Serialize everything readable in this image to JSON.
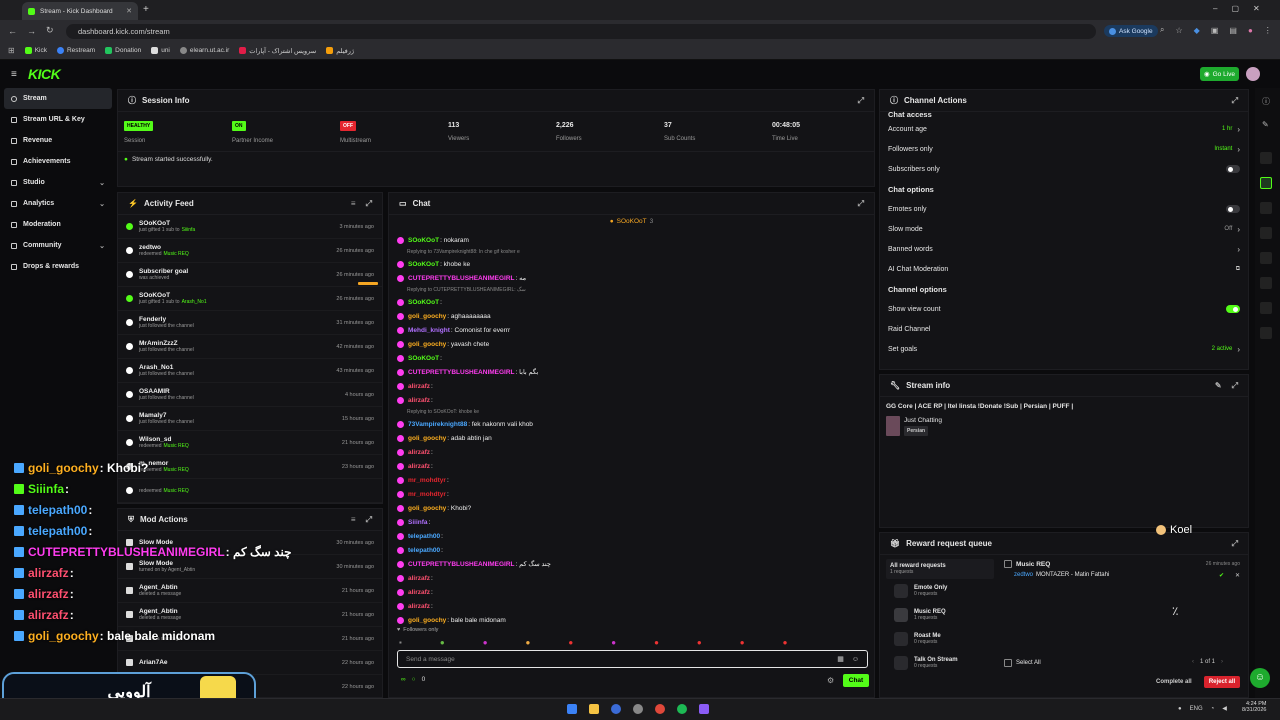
{
  "browser": {
    "tab_title": "Stream - Kick Dashboard",
    "url": "dashboard.kick.com/stream",
    "ask_google": "Ask Google",
    "bookmarks": [
      "Kick",
      "Restream",
      "Donation",
      "uni",
      "elearn.ut.ac.ir",
      "سرویس اشتراک - آپارات",
      "ژرفیلم"
    ]
  },
  "app": {
    "logo": "KICK",
    "go_live": "Go Live"
  },
  "sidebar": {
    "items": [
      {
        "label": "Stream",
        "icon": "stream-icon"
      },
      {
        "label": "Stream URL & Key",
        "icon": "key-icon"
      },
      {
        "label": "Revenue",
        "icon": "revenue-icon"
      },
      {
        "label": "Achievements",
        "icon": "trophy-icon"
      },
      {
        "label": "Studio",
        "icon": "studio-icon",
        "chevron": true
      },
      {
        "label": "Analytics",
        "icon": "chart-icon",
        "chevron": true
      },
      {
        "label": "Moderation",
        "icon": "shield-icon"
      },
      {
        "label": "Community",
        "icon": "people-icon",
        "chevron": true
      },
      {
        "label": "Drops & rewards",
        "icon": "gift-icon"
      }
    ]
  },
  "session": {
    "title": "Session Info",
    "stats": [
      {
        "badge": "HEALTHY",
        "badge_color": "#53fc18",
        "label": "Session"
      },
      {
        "badge": "ON",
        "badge_color": "#53fc18",
        "label": "Partner Income"
      },
      {
        "badge": "OFF",
        "badge_color": "#e5262f",
        "label": "Multistream"
      },
      {
        "value": "113",
        "label": "Viewers"
      },
      {
        "value": "2,226",
        "label": "Followers"
      },
      {
        "value": "37",
        "label": "Sub Counts"
      },
      {
        "value": "00:48:05",
        "label": "Time Live"
      }
    ],
    "notice": "Stream started successfully."
  },
  "activity": {
    "title": "Activity Feed",
    "items": [
      {
        "name": "SOoKOoT",
        "sub": "just gifted 1 sub to",
        "extra": "Siiinfa",
        "time": "3 minutes ago"
      },
      {
        "name": "zedtwo",
        "sub": "redeemed",
        "extra": "Music REQ",
        "time": "26 minutes ago"
      },
      {
        "name": "Subscriber goal",
        "sub": "was achieved",
        "extra": "",
        "time": "26 minutes ago"
      },
      {
        "name": "SOoKOoT",
        "sub": "just gifted 1 sub to",
        "extra": "Arash_No1",
        "time": "26 minutes ago"
      },
      {
        "name": "Fenderly",
        "sub": "just followed the channel",
        "extra": "",
        "time": "31 minutes ago"
      },
      {
        "name": "MrAminZzzZ",
        "sub": "just followed the channel",
        "extra": "",
        "time": "42 minutes ago"
      },
      {
        "name": "Arash_No1",
        "sub": "just followed the channel",
        "extra": "",
        "time": "43 minutes ago"
      },
      {
        "name": "OSAAMIR",
        "sub": "just followed the channel",
        "extra": "",
        "time": "4 hours ago"
      },
      {
        "name": "Mamaly7",
        "sub": "just followed the channel",
        "extra": "",
        "time": "15 hours ago"
      },
      {
        "name": "Wilson_sd",
        "sub": "redeemed",
        "extra": "Music REQ",
        "time": "21 hours ago"
      },
      {
        "name": "m_nemor",
        "sub": "redeemed",
        "extra": "Music REQ",
        "time": "23 hours ago"
      },
      {
        "name": "",
        "sub": "redeemed",
        "extra": "Music REQ",
        "time": ""
      }
    ]
  },
  "modactions": {
    "title": "Mod Actions",
    "items": [
      {
        "name": "Slow Mode",
        "sub": "",
        "time": "30 minutes ago"
      },
      {
        "name": "Slow Mode",
        "sub": "turned on by Agent_Abtin",
        "time": "30 minutes ago"
      },
      {
        "name": "Agent_Abtin",
        "sub": "deleted a message",
        "time": "21 hours ago"
      },
      {
        "name": "Agent_Abtin",
        "sub": "deleted a message",
        "time": "21 hours ago"
      },
      {
        "name": "",
        "sub": "deleted a message",
        "time": "21 hours ago"
      },
      {
        "name": "Arian7Ae",
        "sub": "",
        "time": "22 hours ago"
      },
      {
        "name": "",
        "sub": "",
        "time": "22 hours ago"
      }
    ]
  },
  "chat": {
    "title": "Chat",
    "pinned": "SOoKOoT",
    "pinned_count": "3",
    "input_placeholder": "Send a message",
    "send": "Chat",
    "followers_only": "Followers only",
    "viewer_count": "0",
    "messages": [
      {
        "user": "SOoKOoT",
        "color": "#53fc18",
        "text": ": nokaram"
      },
      {
        "reply": "Replying to 73Vampireknight88: In che gif kosher e"
      },
      {
        "user": "SOoKOoT",
        "color": "#53fc18",
        "text": ": khobe ke"
      },
      {
        "user": "CUTEPRETTYBLUSHEANIMEGIRL",
        "color": "#ff3df0",
        "text": ": مه"
      },
      {
        "reply": "Replying to CUTEPRETTYBLUSHEANIMEGIRL: سگ"
      },
      {
        "user": "SOoKOoT",
        "color": "#53fc18",
        "text": ":"
      },
      {
        "user": "goli_goochy",
        "color": "#ffb020",
        "text": ": aghaaaaaaaa"
      },
      {
        "user": "Mehdi_knight",
        "color": "#b070ff",
        "text": ": Comonist for everrr"
      },
      {
        "user": "goli_goochy",
        "color": "#ffb020",
        "text": ": yavash chete"
      },
      {
        "user": "SOoKOoT",
        "color": "#53fc18",
        "text": ":"
      },
      {
        "user": "CUTEPRETTYBLUSHEANIMEGIRL",
        "color": "#ff3df0",
        "text": ": بگم بابا"
      },
      {
        "user": "alirzafz",
        "color": "#ff5070",
        "text": ":"
      },
      {
        "user": "alirzafz",
        "color": "#ff5070",
        "text": ":"
      },
      {
        "reply": "Replying to SOoKOoT: khobe ke"
      },
      {
        "user": "73Vampireknight88",
        "color": "#4aa8ff",
        "text": ": fek nakonm vali khob"
      },
      {
        "user": "goli_goochy",
        "color": "#ffb020",
        "text": ": adab abtin jan"
      },
      {
        "user": "alirzafz",
        "color": "#ff5070",
        "text": ":"
      },
      {
        "user": "alirzafz",
        "color": "#ff5070",
        "text": ":"
      },
      {
        "user": "mr_mohdtyr",
        "color": "#e5262f",
        "text": ":"
      },
      {
        "user": "mr_mohdtyr",
        "color": "#e5262f",
        "text": ":"
      },
      {
        "user": "goli_goochy",
        "color": "#ffb020",
        "text": ": Khobi?"
      },
      {
        "user": "Siiinfa",
        "color": "#b070ff",
        "text": ":"
      },
      {
        "user": "telepath00",
        "color": "#4aa8ff",
        "text": ":"
      },
      {
        "user": "telepath00",
        "color": "#4aa8ff",
        "text": ":"
      },
      {
        "user": "CUTEPRETTYBLUSHEANIMEGIRL",
        "color": "#ff3df0",
        "text": ": چند سگ کم"
      },
      {
        "user": "alirzafz",
        "color": "#ff5070",
        "text": ":"
      },
      {
        "user": "alirzafz",
        "color": "#ff5070",
        "text": ":"
      },
      {
        "user": "alirzafz",
        "color": "#ff5070",
        "text": ":"
      },
      {
        "user": "goli_goochy",
        "color": "#ffb020",
        "text": ": bale bale midonam"
      }
    ]
  },
  "channel_actions": {
    "title": "Channel Actions",
    "chat_access": {
      "title": "Chat access",
      "options": [
        {
          "label": "Account age",
          "value": "1 hr",
          "kind": "link"
        },
        {
          "label": "Followers only",
          "value": "Instant",
          "kind": "link"
        },
        {
          "label": "Subscribers only",
          "kind": "toggle",
          "on": false
        }
      ]
    },
    "chat_options": {
      "title": "Chat options",
      "options": [
        {
          "label": "Emotes only",
          "kind": "toggle",
          "on": false
        },
        {
          "label": "Slow mode",
          "value": "Off",
          "kind": "link"
        },
        {
          "label": "Banned words",
          "kind": "link"
        },
        {
          "label": "AI Chat Moderation",
          "kind": "ext"
        }
      ]
    },
    "channel_options": {
      "title": "Channel options",
      "options": [
        {
          "label": "Show view count",
          "kind": "toggle",
          "on": true
        },
        {
          "label": "Raid Channel",
          "kind": "none"
        },
        {
          "label": "Set goals",
          "value": "2 active",
          "kind": "link"
        }
      ]
    }
  },
  "stream_info": {
    "title": "Stream info",
    "stream_title": "GG Core | ACE RP | Itel Iinsta !Donate !Sub | Persian | PUFF |",
    "category": "Just Chatting",
    "tag": "Persian"
  },
  "reward_queue": {
    "title": "Reward request queue",
    "all": "All reward requests",
    "all_sub": "1 requests",
    "rewards": [
      {
        "name": "Emote Only",
        "sub": "0 requests"
      },
      {
        "name": "Music REQ",
        "sub": "1 requests"
      },
      {
        "name": "Roast Me",
        "sub": "0 requests"
      },
      {
        "name": "Talk On Stream",
        "sub": "0 requests"
      }
    ],
    "request": {
      "title": "Music REQ",
      "time": "26 minutes ago",
      "user": "zedtwo",
      "text": "MONTAZER - Matin Fattahi"
    },
    "select_all": "Select All",
    "pagination": "1 of 1",
    "complete": "Complete all",
    "reject": "Reject all"
  },
  "overlay": {
    "lines": [
      {
        "user": "goli_goochy",
        "color": "#ffb020",
        "text": ": Khobi?"
      },
      {
        "user": "Siiinfa",
        "color": "#53fc18",
        "text": ":"
      },
      {
        "user": "telepath00",
        "color": "#4aa8ff",
        "text": ":"
      },
      {
        "user": "telepath00",
        "color": "#4aa8ff",
        "text": ":"
      },
      {
        "user": "CUTEPRETTYBLUSHEANIMEGIRL",
        "color": "#ff3df0",
        "text": ": چند سگ کم"
      },
      {
        "user": "alirzafz",
        "color": "#ff5070",
        "text": ":"
      },
      {
        "user": "alirzafz",
        "color": "#ff5070",
        "text": ":"
      },
      {
        "user": "alirzafz",
        "color": "#ff5070",
        "text": ":"
      },
      {
        "user": "goli_goochy",
        "color": "#ffb020",
        "text": ": bale bale midonam"
      }
    ],
    "banner": "آلووپی",
    "koel": "Koel"
  },
  "taskbar": {
    "lang": "ENG",
    "time": "4:24 PM",
    "date": "8/31/2026"
  }
}
